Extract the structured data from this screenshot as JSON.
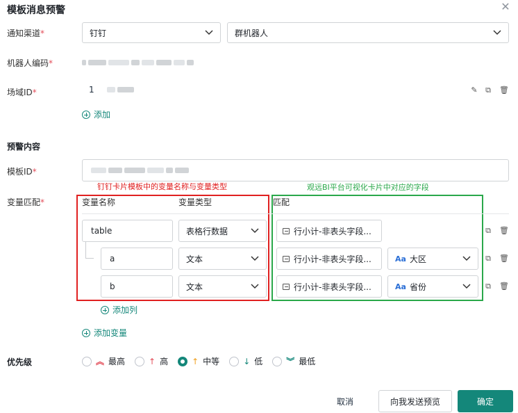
{
  "dialog": {
    "title": "模板消息预警"
  },
  "notify": {
    "label": "通知渠道",
    "channel": "钉钉",
    "target": "群机器人"
  },
  "robot": {
    "label": "机器人编码"
  },
  "domain": {
    "label": "场域ID",
    "value": "1",
    "add_label": "添加"
  },
  "alert": {
    "section": "预警内容",
    "template_label": "模板ID",
    "var_label": "变量匹配",
    "red_note": "钉钉卡片模板中的变量名称与变量类型",
    "green_note": "观远BI平台可视化卡片中对应的字段",
    "col_name": "变量名称",
    "col_type": "变量类型",
    "col_match": "匹配",
    "rows": [
      {
        "name": "table",
        "type": "表格行数据",
        "field": "行小计-非表头字段..."
      },
      {
        "name": "a",
        "type": "文本",
        "field": "行小计-非表头字段...",
        "dim": "大区"
      },
      {
        "name": "b",
        "type": "文本",
        "field": "行小计-非表头字段...",
        "dim": "省份"
      }
    ],
    "add_column": "添加列",
    "add_variable": "添加变量",
    "dim_icon": "Aa"
  },
  "priority": {
    "label": "优先级",
    "options": [
      {
        "label": "最高",
        "arrow": "≈",
        "color": "#e34d59"
      },
      {
        "label": "高",
        "arrow": "↑",
        "color": "#e34d59"
      },
      {
        "label": "中等",
        "arrow": "↑",
        "color": "#f0a020"
      },
      {
        "label": "低",
        "arrow": "↓",
        "color": "#14877a"
      },
      {
        "label": "最低",
        "arrow": "≈",
        "color": "#14877a"
      }
    ],
    "selected": "中等"
  },
  "footer": {
    "cancel": "取消",
    "preview": "向我发送预览",
    "confirm": "确定"
  },
  "colors": {
    "accent": "#14877a",
    "required": "#e34d59"
  }
}
